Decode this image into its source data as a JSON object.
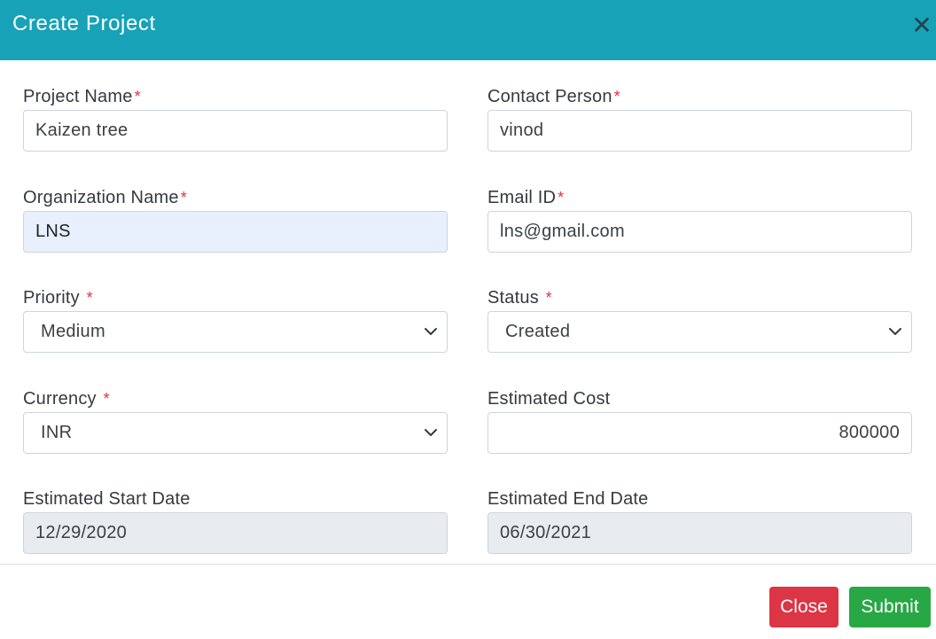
{
  "modal": {
    "title": "Create Project",
    "close_icon": "close-icon",
    "close_glyph": "✕"
  },
  "form": {
    "project_name": {
      "label": "Project Name",
      "required_mark": "*",
      "value": "Kaizen tree"
    },
    "contact_person": {
      "label": "Contact Person",
      "required_mark": "*",
      "value": "vinod"
    },
    "organization_name": {
      "label": "Organization Name",
      "required_mark": "*",
      "value": "LNS"
    },
    "email_id": {
      "label": "Email ID",
      "required_mark": "*",
      "value": "lns@gmail.com"
    },
    "priority": {
      "label": "Priority ",
      "required_mark": "*",
      "selected": "Medium"
    },
    "status": {
      "label": "Status ",
      "required_mark": "*",
      "selected": "Created"
    },
    "currency": {
      "label": "Currency ",
      "required_mark": "*",
      "selected": "INR"
    },
    "estimated_cost": {
      "label": "Estimated Cost",
      "value": "800000"
    },
    "estimated_start_date": {
      "label": "Estimated Start Date",
      "value": "12/29/2020"
    },
    "estimated_end_date": {
      "label": "Estimated End Date",
      "value": "06/30/2021"
    }
  },
  "footer": {
    "close_label": "Close",
    "submit_label": "Submit"
  },
  "colors": {
    "header": "#17a2b8",
    "required": "#dc3545",
    "close_button": "#dc3545",
    "submit_button": "#28a745",
    "autofill_bg": "#e8f0fe",
    "readonly_bg": "#e9ecef"
  }
}
